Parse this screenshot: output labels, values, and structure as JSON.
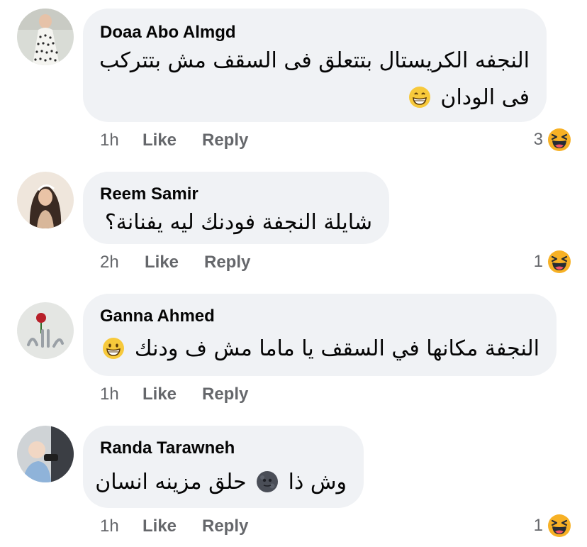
{
  "comments": [
    {
      "author": "Doaa Abo Almgd",
      "text_lines": [
        "النجفه الكريستال بتتعلق فى السقف مش بتتركب",
        "فى الودان"
      ],
      "emoji": "grinning-emoji",
      "time": "1h",
      "like": "Like",
      "reply": "Reply",
      "reaction_count": "3",
      "reaction_icon": "laughing-reaction-icon"
    },
    {
      "author": "Reem Samir",
      "text_lines": [
        "شايلة النجفة فودنك ليه يفنانة؟"
      ],
      "time": "2h",
      "like": "Like",
      "reply": "Reply",
      "reaction_count": "1",
      "reaction_icon": "laughing-reaction-icon"
    },
    {
      "author": "Ganna Ahmed",
      "text_lines": [
        "النجفة  مكانها في السقف يا ماما مش ف ودنك"
      ],
      "emoji": "grinning-emoji",
      "time": "1h",
      "like": "Like",
      "reply": "Reply"
    },
    {
      "author": "Randa Tarawneh",
      "text_lines": [
        "وش ذا",
        "حلق مزينه انسان"
      ],
      "emoji": "new-moon-face-emoji",
      "time": "1h",
      "like": "Like",
      "reply": "Reply",
      "reaction_count": "1",
      "reaction_icon": "laughing-reaction-icon"
    }
  ],
  "colors": {
    "bubble_bg": "#f0f2f5",
    "meta_text": "#65676b",
    "text": "#050505",
    "reaction_yellow": "#f7b125"
  }
}
